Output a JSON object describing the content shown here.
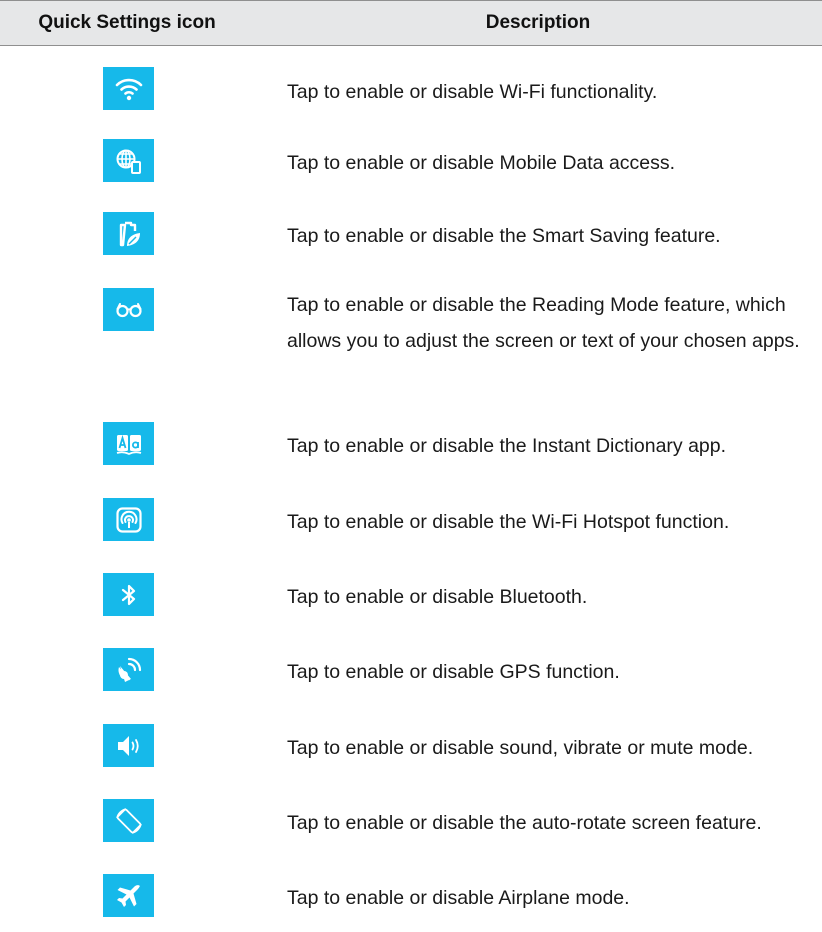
{
  "header": {
    "icon_col": "Quick Settings icon",
    "desc_col": "Description"
  },
  "rows": [
    {
      "icon": "wifi-icon",
      "text": "Tap to enable or disable Wi-Fi functionality."
    },
    {
      "icon": "mobile-data-icon",
      "text": "Tap to enable or disable Mobile Data access."
    },
    {
      "icon": "smart-saving-icon",
      "text": "Tap to enable or disable the Smart Saving feature."
    },
    {
      "icon": "reading-mode-icon",
      "text": "Tap to enable or disable the Reading Mode feature, which allows you to adjust the screen or text of your chosen apps."
    },
    {
      "icon": "instant-dictionary-icon",
      "text": "Tap to enable or disable the Instant Dictionary app."
    },
    {
      "icon": "hotspot-icon",
      "text": "Tap to enable or disable the Wi-Fi Hotspot function."
    },
    {
      "icon": "bluetooth-icon",
      "text": "Tap to enable or disable Bluetooth."
    },
    {
      "icon": "gps-icon",
      "text": "Tap to enable or disable GPS function."
    },
    {
      "icon": "sound-icon",
      "text": "Tap to enable or disable sound, vibrate or mute mode."
    },
    {
      "icon": "auto-rotate-icon",
      "text": "Tap to enable or disable the auto-rotate screen feature."
    },
    {
      "icon": "airplane-icon",
      "text": "Tap to enable or disable Airplane mode."
    }
  ],
  "colors": {
    "tile": "#16b9ea",
    "header_bg": "#e6e7e8"
  }
}
